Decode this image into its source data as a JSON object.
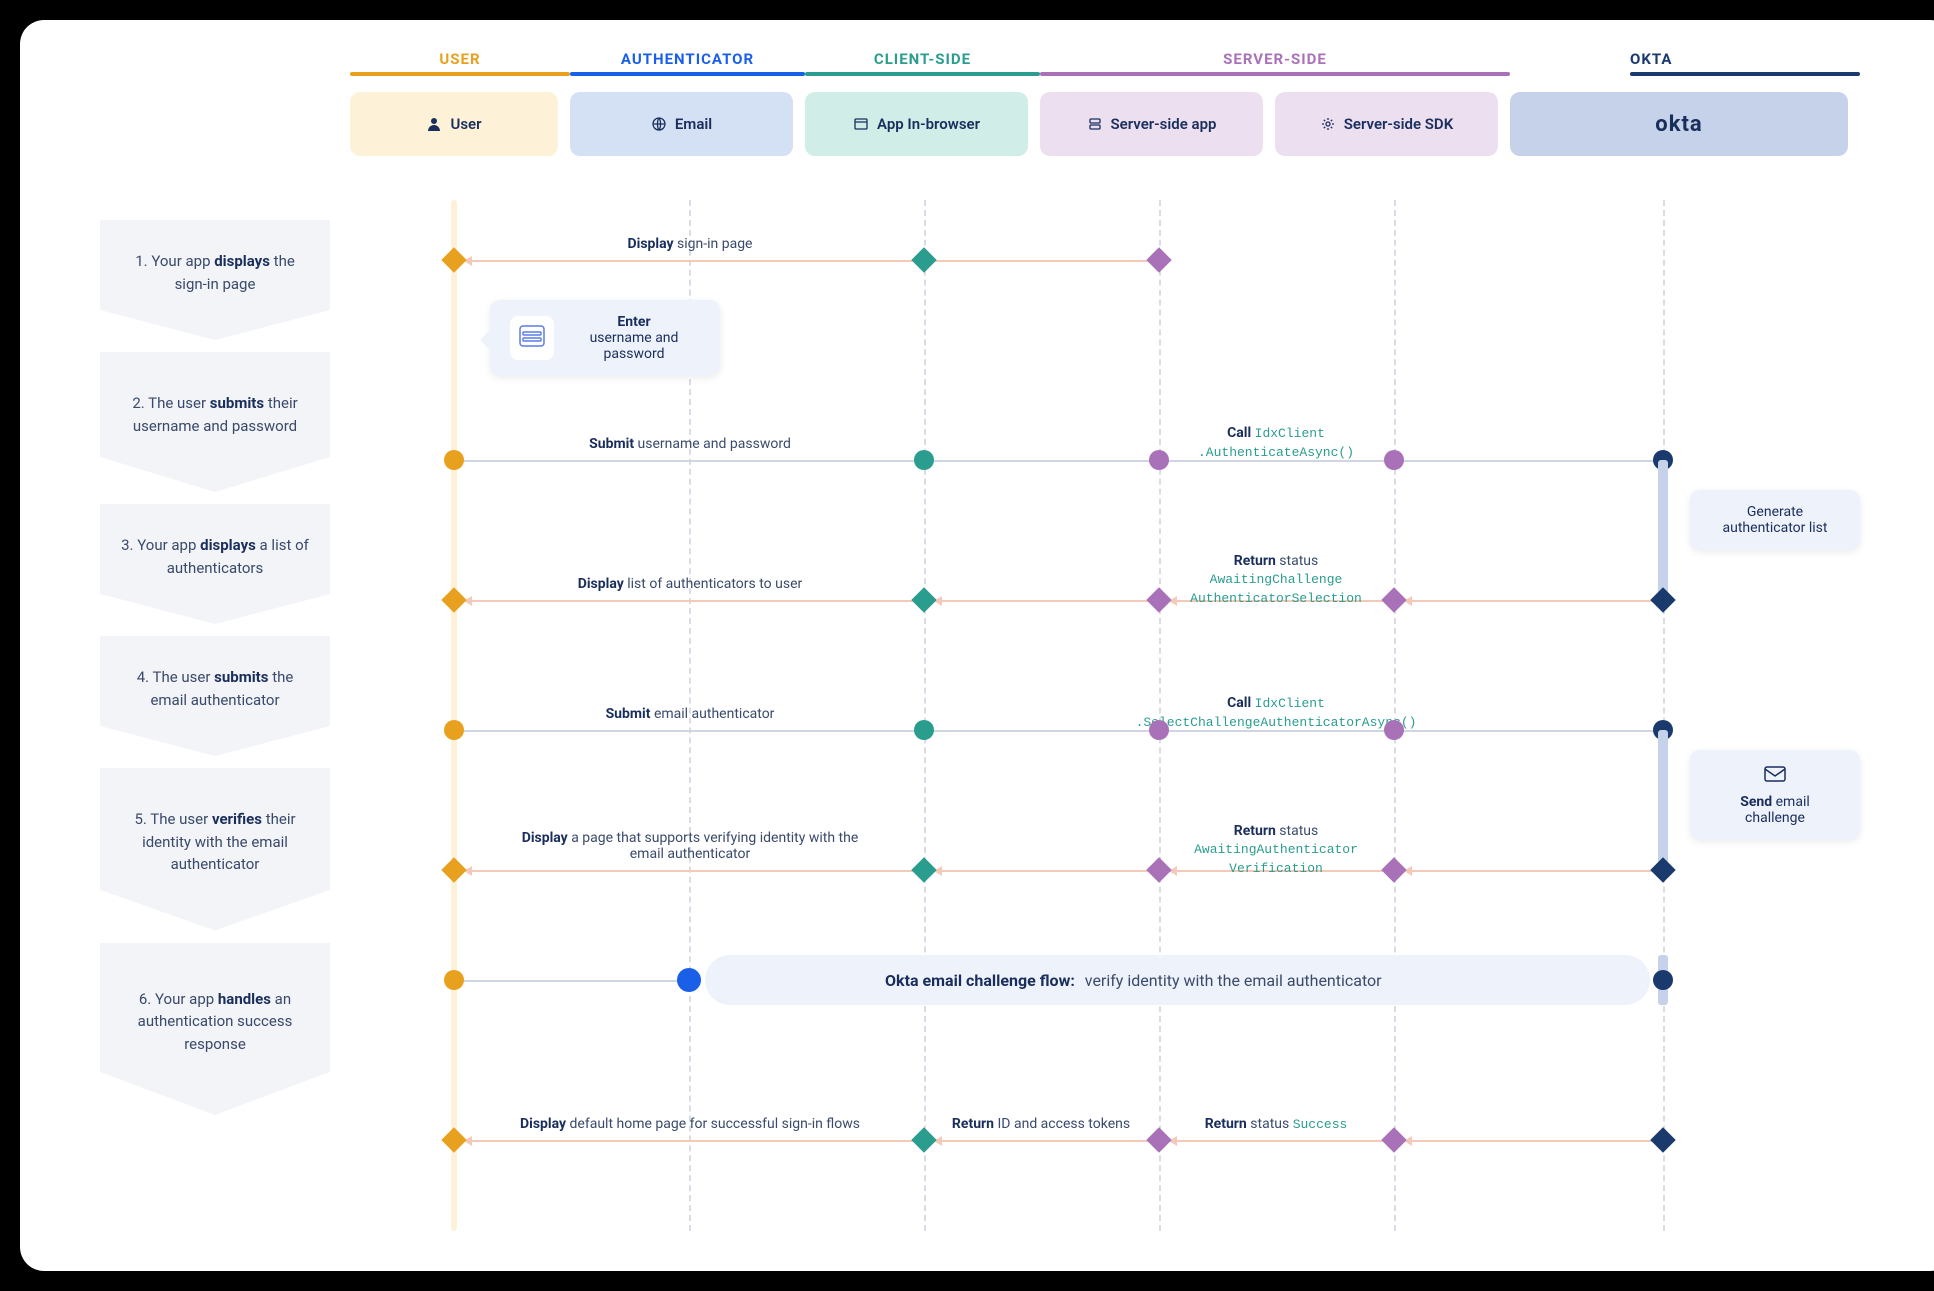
{
  "lanes": {
    "user": {
      "header": "USER",
      "box": "User"
    },
    "auth": {
      "header": "AUTHENTICATOR",
      "box": "Email"
    },
    "client": {
      "header": "CLIENT-SIDE",
      "box": "App In-browser"
    },
    "server": {
      "header": "SERVER-SIDE",
      "box1": "Server-side app",
      "box2": "Server-side SDK"
    },
    "okta": {
      "header": "OKTA",
      "box": "okta"
    }
  },
  "steps": [
    {
      "num": "1.",
      "pre": "Your app ",
      "bold": "displays",
      "post": " the sign-in page"
    },
    {
      "num": "2.",
      "pre": "The user ",
      "bold": "submits",
      "post": " their username and password"
    },
    {
      "num": "3.",
      "pre": "Your app ",
      "bold": "displays",
      "post": " a list of authenticators"
    },
    {
      "num": "4.",
      "pre": "The user ",
      "bold": "submits",
      "post": " the email authenticator"
    },
    {
      "num": "5.",
      "pre": "The user ",
      "bold": "verifies",
      "post": " their identity with the email authenticator"
    },
    {
      "num": "6.",
      "pre": "Your app ",
      "bold": "handles",
      "post": " an authentication success response"
    }
  ],
  "labels": {
    "r1_display": "sign-in page",
    "enter_title": "Enter",
    "enter_body": "username and password",
    "r2_submit": "username and password",
    "r2_call_pre": "Call ",
    "r2_call_code": "IdxClient\n.AuthenticateAsync()",
    "gen_list": "Generate authenticator list",
    "r3_return_pre": "Return ",
    "r3_return_status": "status",
    "r3_return_code": "AwaitingChallenge\nAuthenticatorSelection",
    "r3_display": "list of authenticators to user",
    "r4_submit": "email authenticator",
    "r4_call_pre": "Call ",
    "r4_call_code": "IdxClient\n.SelectChallengeAuthenticatorAsync()",
    "send_title": "Send",
    "send_body": " email challenge",
    "r5_return_pre": "Return ",
    "r5_return_status": "status",
    "r5_return_code": "AwaitingAuthenticator\nVerification",
    "r5_display": "a page that supports verifying identity with the email authenticator",
    "challenge_title": "Okta email challenge flow:",
    "challenge_body": " verify identity with the email authenticator",
    "r6_display": "default home page for successful sign-in flows",
    "r6_return_tokens_pre": "Return ",
    "r6_return_tokens": "ID and access tokens",
    "r6_return_status_pre": "Return ",
    "r6_return_status": "status ",
    "r6_return_status_code": "Success",
    "bold_display": "Display",
    "bold_submit": "Submit",
    "bold_call": "Call",
    "bold_return": "Return",
    "bold_enter": "Enter",
    "bold_send": "Send"
  }
}
